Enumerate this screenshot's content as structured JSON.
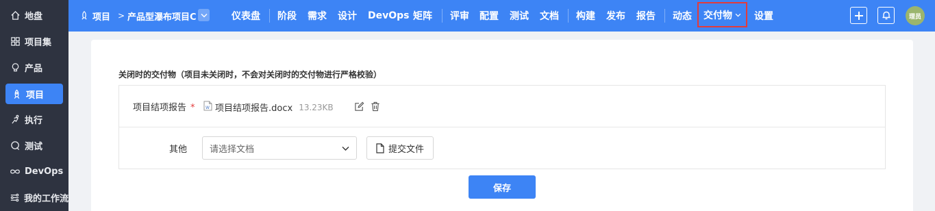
{
  "sidebar": {
    "items": [
      {
        "label": "地盘",
        "icon": "home-icon"
      },
      {
        "label": "项目集",
        "icon": "grid-icon"
      },
      {
        "label": "产品",
        "icon": "lightbulb-icon"
      },
      {
        "label": "项目",
        "icon": "rocket-icon",
        "active": true
      },
      {
        "label": "执行",
        "icon": "sprint-icon"
      },
      {
        "label": "测试",
        "icon": "test-icon"
      },
      {
        "label": "DevOps",
        "icon": "infinity-icon"
      },
      {
        "label": "我的工作流",
        "icon": "workflow-icon"
      }
    ]
  },
  "header": {
    "breadcrumb_root": "项目",
    "breadcrumb_sep": ">",
    "breadcrumb_project": "产品型瀑布项目C",
    "nav": [
      "仪表盘",
      "阶段",
      "需求",
      "设计",
      "DevOps",
      "矩阵",
      "评审",
      "配置",
      "测试",
      "文档",
      "构建",
      "发布",
      "报告",
      "动态",
      "交付物",
      "设置"
    ],
    "current_nav": "交付物",
    "avatar_text": "理员",
    "accent_color": "#3d84f5",
    "highlight_color": "#e33b3b"
  },
  "form": {
    "section_title": "关闭时的交付物（项目未关闭时，不会对关闭时的交付物进行严格校验）",
    "row1": {
      "label": "项目结项报告",
      "required_mark": "*",
      "file_name": "项目结项报告.docx",
      "file_size": "13.23KB"
    },
    "row2": {
      "label": "其他",
      "select_placeholder": "请选择文档",
      "upload_label": "提交文件"
    },
    "save_label": "保存"
  }
}
